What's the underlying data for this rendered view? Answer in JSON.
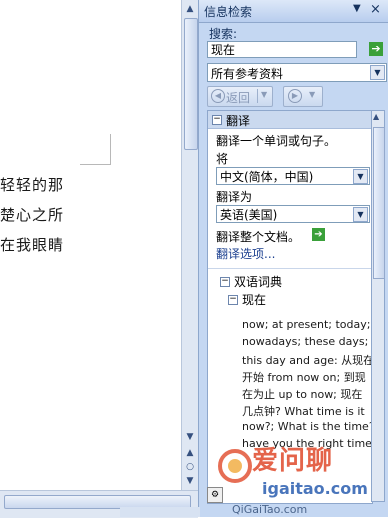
{
  "document": {
    "lines": [
      "轻轻的那",
      "楚心之所",
      "在我眼睛"
    ]
  },
  "pane": {
    "title": "信息检索",
    "search_label": "搜索:",
    "search_value": "现在",
    "source": "所有参考资料",
    "back_label": "返回",
    "section_title": "翻译",
    "translate_prompt": "翻译一个单词或句子。",
    "from_label": "将",
    "from_lang": "中文(简体，中国)",
    "to_label": "翻译为",
    "to_lang": "英语(美国)",
    "translate_doc": "翻译整个文档。",
    "translate_options": "翻译选项...",
    "dict_title": "双语词典",
    "entry": "现在",
    "definitions": [
      "now; at present; today;",
      "nowadays; these days;",
      "this day and age: 从现在",
      "开始 from now on; 到现",
      "在为止 up to now; 现在",
      "几点钟? What time is it",
      "now?; What is the time?;",
      "have you the right time?"
    ]
  },
  "watermark": {
    "brand": "爱问聊",
    "url": "igaitao.com",
    "url2": "QiGaiTao.com"
  },
  "colors": {
    "pane_bg": "#c4d7f2",
    "go_green": "#3aa03a",
    "link_blue": "#1b3f8f"
  }
}
